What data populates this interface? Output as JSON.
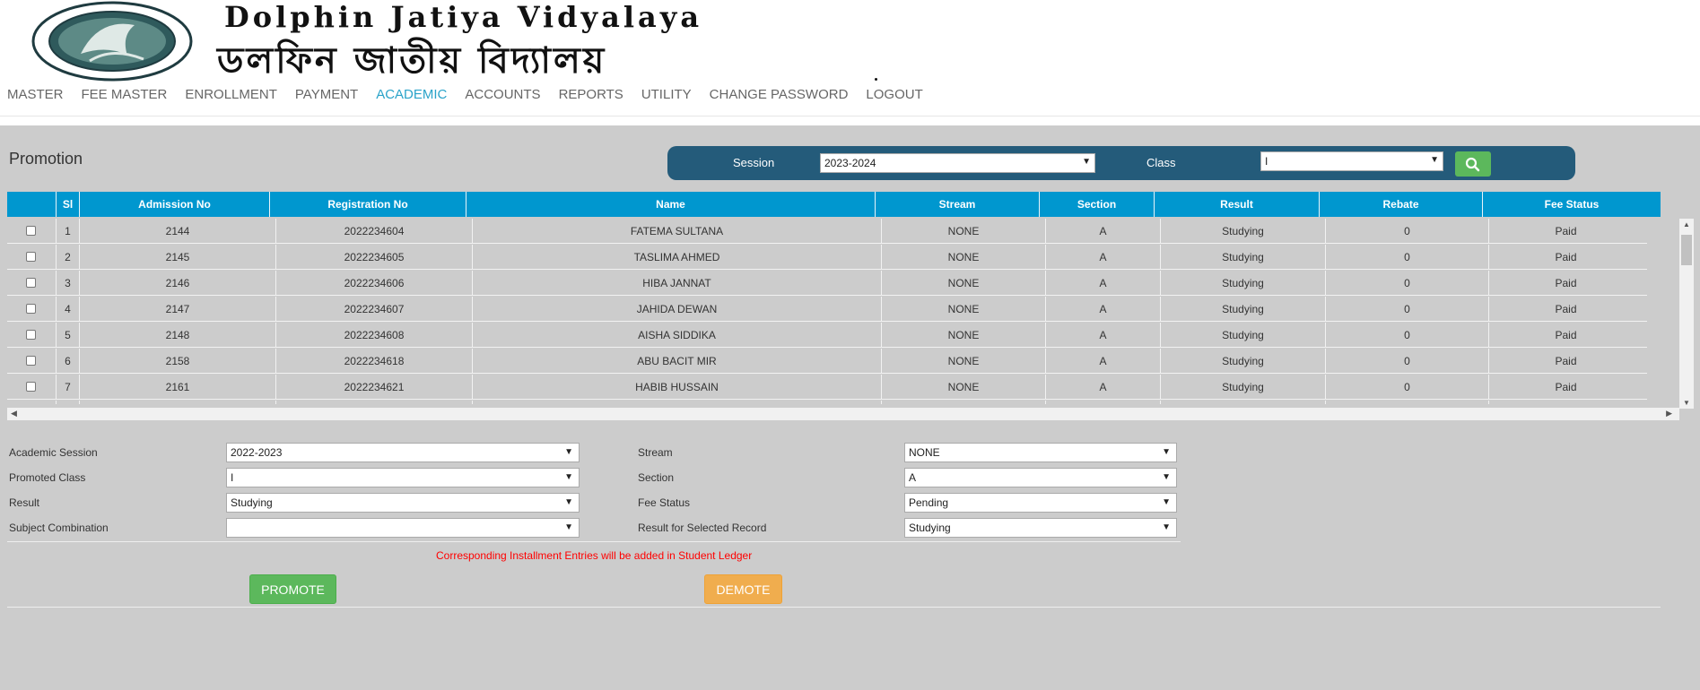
{
  "header": {
    "title_en": "Dolphin Jatiya Vidyalaya",
    "title_bn": "ডলফিন জাতীয় বিদ্যালয়",
    "logo_icon": "school-seal-logo",
    "nav": [
      {
        "label": "MASTER",
        "active": false
      },
      {
        "label": "FEE MASTER",
        "active": false
      },
      {
        "label": "ENROLLMENT",
        "active": false
      },
      {
        "label": "PAYMENT",
        "active": false
      },
      {
        "label": "ACADEMIC",
        "active": true
      },
      {
        "label": "ACCOUNTS",
        "active": false
      },
      {
        "label": "REPORTS",
        "active": false
      },
      {
        "label": "UTILITY",
        "active": false
      },
      {
        "label": "CHANGE PASSWORD",
        "active": false
      },
      {
        "label": "LOGOUT",
        "active": false
      }
    ]
  },
  "page": {
    "title": "Promotion"
  },
  "filter": {
    "session_label": "Session",
    "session_value": "2023-2024",
    "class_label": "Class",
    "class_value": "I",
    "search_icon": "search-icon"
  },
  "table": {
    "columns": [
      "Sl",
      "Admission No",
      "Registration No",
      "Name",
      "Stream",
      "Section",
      "Result",
      "Rebate",
      "Fee Status"
    ],
    "rows": [
      {
        "sl": "1",
        "admission": "2144",
        "registration": "2022234604",
        "name": "FATEMA SULTANA",
        "stream": "NONE",
        "section": "A",
        "result": "Studying",
        "rebate": "0",
        "fee_status": "Paid"
      },
      {
        "sl": "2",
        "admission": "2145",
        "registration": "2022234605",
        "name": "TASLIMA AHMED",
        "stream": "NONE",
        "section": "A",
        "result": "Studying",
        "rebate": "0",
        "fee_status": "Paid"
      },
      {
        "sl": "3",
        "admission": "2146",
        "registration": "2022234606",
        "name": "HIBA JANNAT",
        "stream": "NONE",
        "section": "A",
        "result": "Studying",
        "rebate": "0",
        "fee_status": "Paid"
      },
      {
        "sl": "4",
        "admission": "2147",
        "registration": "2022234607",
        "name": "JAHIDA DEWAN",
        "stream": "NONE",
        "section": "A",
        "result": "Studying",
        "rebate": "0",
        "fee_status": "Paid"
      },
      {
        "sl": "5",
        "admission": "2148",
        "registration": "2022234608",
        "name": "AISHA SIDDIKA",
        "stream": "NONE",
        "section": "A",
        "result": "Studying",
        "rebate": "0",
        "fee_status": "Paid"
      },
      {
        "sl": "6",
        "admission": "2158",
        "registration": "2022234618",
        "name": "ABU BACIT MIR",
        "stream": "NONE",
        "section": "A",
        "result": "Studying",
        "rebate": "0",
        "fee_status": "Paid"
      },
      {
        "sl": "7",
        "admission": "2161",
        "registration": "2022234621",
        "name": "HABIB HUSSAIN",
        "stream": "NONE",
        "section": "A",
        "result": "Studying",
        "rebate": "0",
        "fee_status": "Paid"
      }
    ]
  },
  "form": {
    "academic_session_label": "Academic Session",
    "academic_session_value": "2022-2023",
    "promoted_class_label": "Promoted Class",
    "promoted_class_value": "I",
    "result_label": "Result",
    "result_value": "Studying",
    "subject_combination_label": "Subject Combination",
    "subject_combination_value": "",
    "stream_label": "Stream",
    "stream_value": "NONE",
    "section_label": "Section",
    "section_value": "A",
    "fee_status_label": "Fee Status",
    "fee_status_value": "Pending",
    "selected_result_label": "Result for Selected Record",
    "selected_result_value": "Studying",
    "notice": "Corresponding Installment Entries will be added in Student Ledger",
    "promote_label": "PROMOTE",
    "demote_label": "DEMOTE"
  },
  "colors": {
    "nav_active": "#2aa3c9",
    "filter_bar": "#245b7a",
    "table_header": "#0097cf",
    "promote": "#5cb85c",
    "demote": "#f0ad4e",
    "notice": "#ff0000"
  }
}
